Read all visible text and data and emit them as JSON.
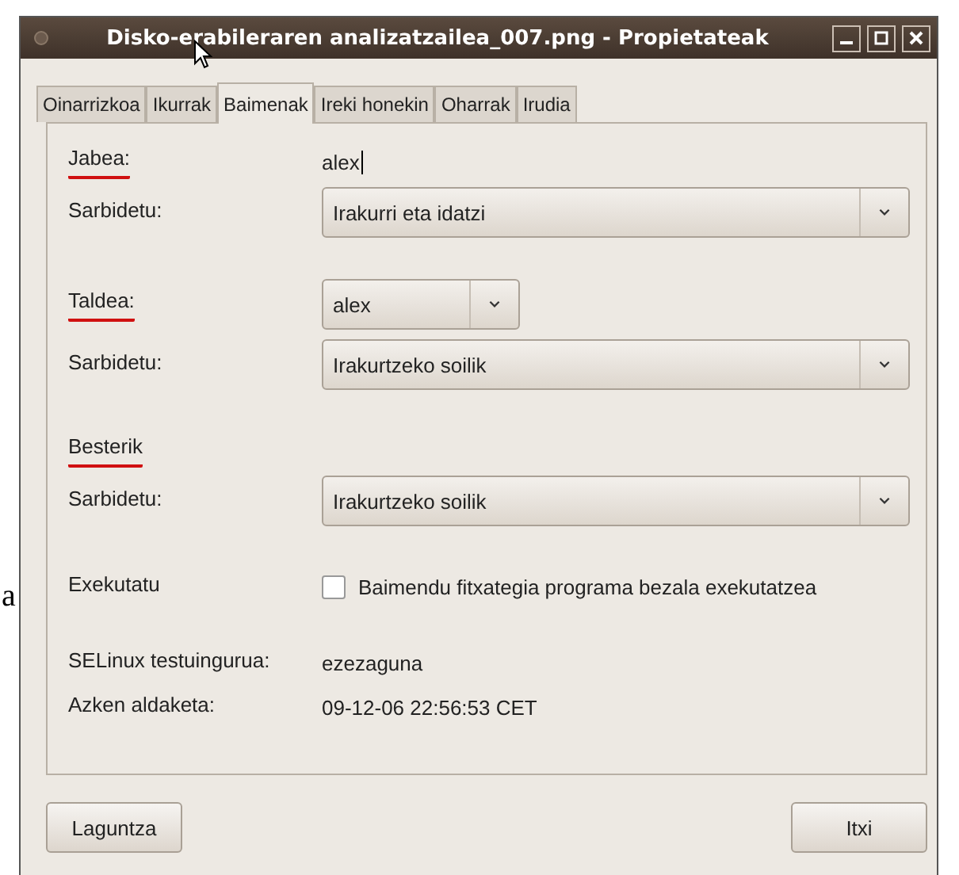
{
  "background_fragment": "a",
  "window": {
    "title": "Disko-erabileraren analizatzailea_007.png - Propietateak"
  },
  "tabs": [
    {
      "label": "Oinarrizkoa",
      "selected": false
    },
    {
      "label": "Ikurrak",
      "selected": false
    },
    {
      "label": "Baimenak",
      "selected": true
    },
    {
      "label": "Ireki honekin",
      "selected": false
    },
    {
      "label": "Oharrak",
      "selected": false
    },
    {
      "label": "Irudia",
      "selected": false
    }
  ],
  "rows": [
    {
      "kind": "text",
      "label": "Jabea:",
      "annotated": true,
      "value": "alex"
    },
    {
      "kind": "combo",
      "label": "Sarbidetu:",
      "annotated": false,
      "value": "Irakurri eta idatzi",
      "wide": true
    },
    {
      "kind": "gap"
    },
    {
      "kind": "combo",
      "label": "Taldea:",
      "annotated": true,
      "value": "alex",
      "wide": false
    },
    {
      "kind": "combo",
      "label": "Sarbidetu:",
      "annotated": false,
      "value": "Irakurtzeko soilik",
      "wide": true
    },
    {
      "kind": "gap"
    },
    {
      "kind": "heading",
      "label": "Besterik",
      "annotated": true
    },
    {
      "kind": "combo",
      "label": "Sarbidetu:",
      "annotated": false,
      "value": "Irakurtzeko soilik",
      "wide": true
    },
    {
      "kind": "gap"
    },
    {
      "kind": "check",
      "label": "Exekutatu",
      "annotated": false,
      "value": "Baimendu fitxategia programa bezala exekutatzea",
      "checked": false
    },
    {
      "kind": "gap"
    },
    {
      "kind": "text",
      "label": "SELinux testuingurua:",
      "annotated": false,
      "value": "ezezaguna"
    },
    {
      "kind": "text",
      "label": "Azken aldaketa:",
      "annotated": false,
      "value": "09-12-06 22:56:53 CET"
    }
  ],
  "buttons": [
    {
      "label": "Laguntza"
    },
    {
      "label": "Itxi"
    }
  ]
}
